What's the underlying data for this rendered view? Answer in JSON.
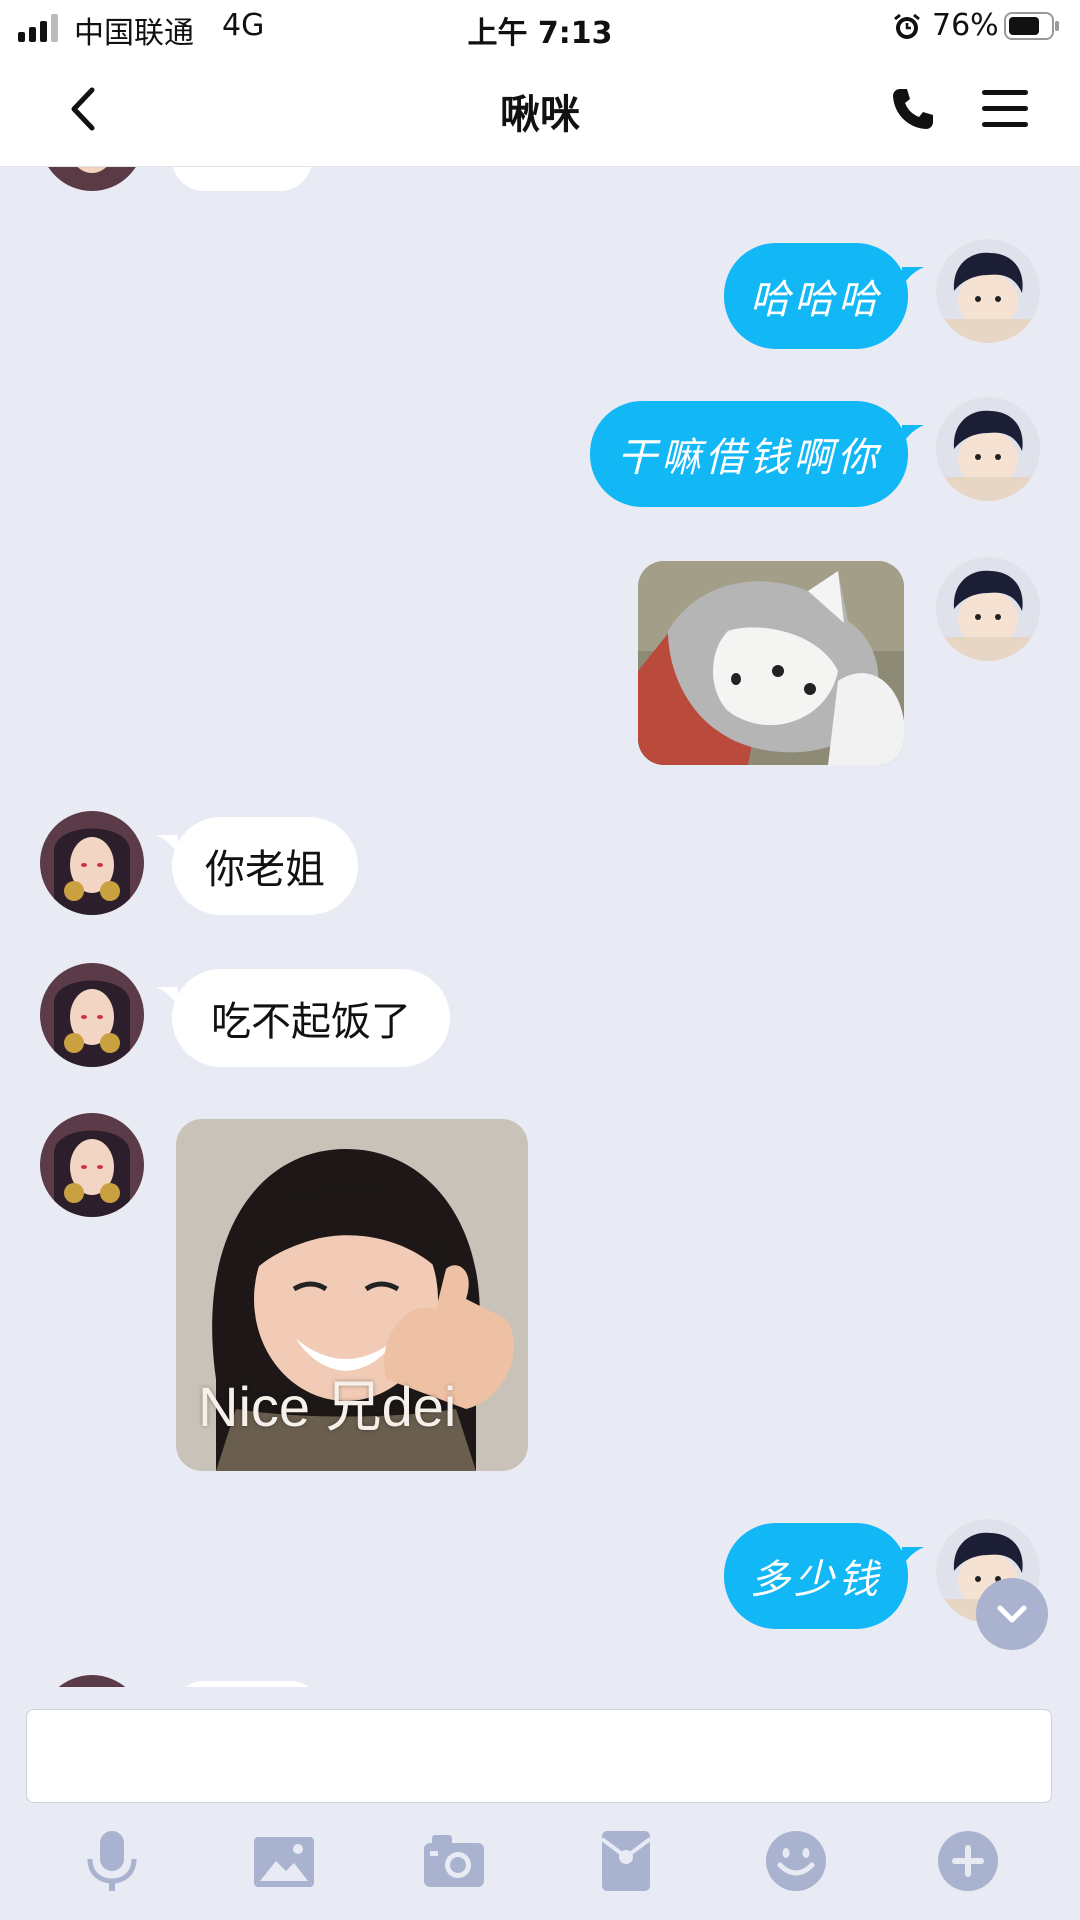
{
  "status_bar": {
    "carrier": "中国联通",
    "network": "4G",
    "time": "上午 7:13",
    "battery": "76%"
  },
  "nav": {
    "title": "啾咪"
  },
  "messages": [
    {
      "sender": "me",
      "type": "text",
      "text": "哈哈哈"
    },
    {
      "sender": "me",
      "type": "text",
      "text": "干嘛借钱啊你"
    },
    {
      "sender": "me",
      "type": "sticker",
      "icon": "dog-sticker"
    },
    {
      "sender": "them",
      "type": "text",
      "text": "你老姐"
    },
    {
      "sender": "them",
      "type": "text",
      "text": "吃不起饭了"
    },
    {
      "sender": "them",
      "type": "sticker",
      "icon": "thumbs-up-girl-sticker",
      "caption": "Nice 兄dei"
    },
    {
      "sender": "me",
      "type": "text",
      "text": "多少钱"
    }
  ],
  "input": {
    "placeholder": ""
  },
  "toolbar": [
    "microphone-icon",
    "image-icon",
    "camera-icon",
    "red-packet-icon",
    "emoji-icon",
    "plus-icon"
  ],
  "colors": {
    "me_bubble": "#12b7f5",
    "them_bubble": "#ffffff",
    "background": "#e9ebf4",
    "icon": "#a9b3cf"
  }
}
